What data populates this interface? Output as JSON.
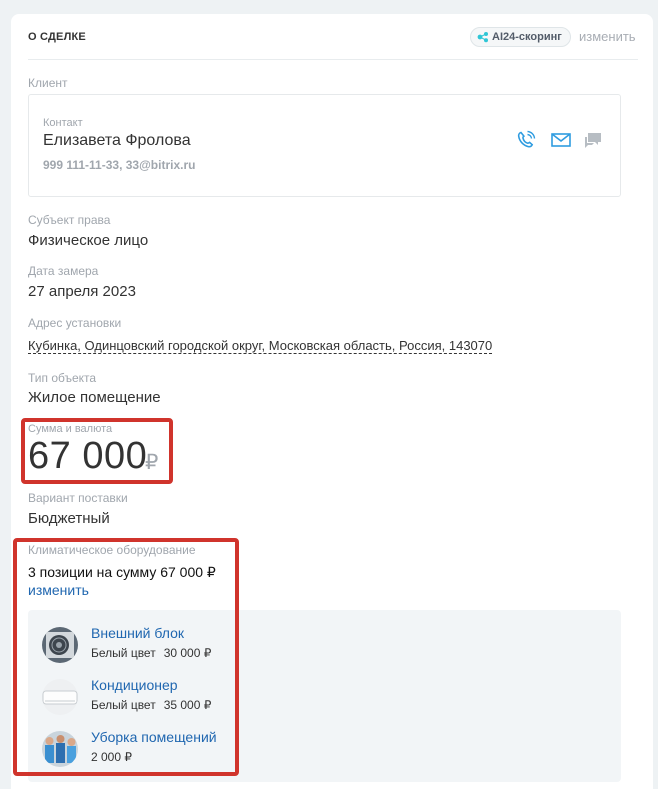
{
  "header": {
    "title": "О СДЕЛКЕ",
    "ai_badge": "AI24-скоринг",
    "change": "изменить"
  },
  "client": {
    "section_label": "Клиент",
    "contact_label": "Контакт",
    "name": "Елизавета Фролова",
    "info": "999 111-11-33, 33@bitrix.ru",
    "icons": [
      "phone-icon",
      "mail-icon",
      "chat-icon"
    ]
  },
  "fields": {
    "subject_label": "Субъект права",
    "subject_value": "Физическое лицо",
    "date_label": "Дата замера",
    "date_value": "27 апреля 2023",
    "address_label": "Адрес установки",
    "address_value": "Кубинка, Одинцовский городской округ, Московская область, Россия, 143070",
    "object_label": "Тип объекта",
    "object_value": "Жилое помещение",
    "sum_label": "Сумма и валюта",
    "sum_value": "67 000",
    "sum_currency": "₽",
    "delivery_label": "Вариант поставки",
    "delivery_value": "Бюджетный"
  },
  "equipment": {
    "label": "Климатическое оборудование",
    "summary": "3 позиции на сумму 67 000 ₽",
    "change": "изменить",
    "items": [
      {
        "name": "Внешний блок",
        "variant": "Белый цвет",
        "price": "30 000 ₽"
      },
      {
        "name": "Кондиционер",
        "variant": "Белый цвет",
        "price": "35 000 ₽"
      },
      {
        "name": "Уборка помещений",
        "variant": "",
        "price": "2 000 ₽"
      }
    ]
  },
  "colors": {
    "accent": "#2067b0",
    "highlight": "#d0342c",
    "icon_blue": "#2f9ce0",
    "icon_grey": "#b7bdc3"
  }
}
